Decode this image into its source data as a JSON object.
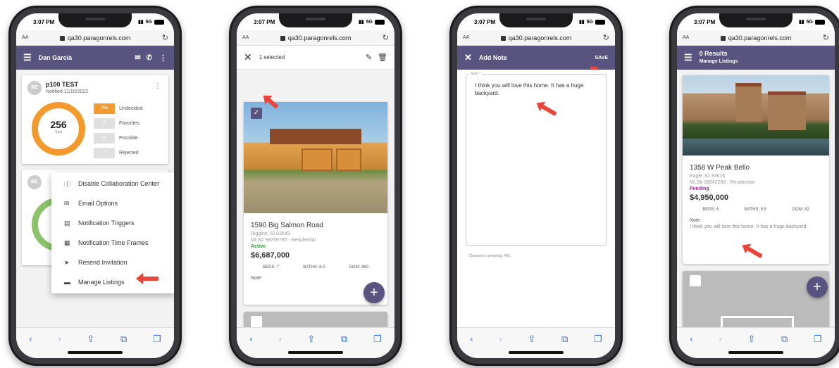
{
  "device": {
    "time": "3:07 PM",
    "network": "5G",
    "url_prefix": "AA",
    "url": "qa30.paragonrels.com",
    "reload_icon": "reload-icon"
  },
  "colors": {
    "appbar": "#58537f",
    "accent_orange": "#f29a2e",
    "active_green": "#2e9a3a",
    "pending_purple": "#9a2e9a",
    "annotation_red": "#e8453c"
  },
  "screen1": {
    "user_name": "Dan Garcia",
    "card": {
      "avatar": "BE",
      "title": "p100 TEST",
      "subtitle": "Notified 11/10/2022",
      "total_value": "256",
      "total_label": "Total",
      "breakdown": [
        {
          "count": "256",
          "label": "Undecided"
        },
        {
          "count": "0",
          "label": "Favorites"
        },
        {
          "count": "0",
          "label": "Possible"
        },
        {
          "count": "0",
          "label": "Rejected"
        }
      ]
    },
    "card2_avatar": "BE",
    "menu": [
      {
        "icon": "info-icon",
        "label": "Disable Collaboration Center"
      },
      {
        "icon": "email-icon",
        "label": "Email Options"
      },
      {
        "icon": "notification-trigger-icon",
        "label": "Notification Triggers"
      },
      {
        "icon": "calendar-icon",
        "label": "Notification Time Frames"
      },
      {
        "icon": "send-icon",
        "label": "Resend Invitation"
      },
      {
        "icon": "folder-icon",
        "label": "Manage Listings"
      }
    ]
  },
  "screen2": {
    "selected_text": "1 selected",
    "listing": {
      "address": "1590 Big Salmon Road",
      "city": "Riggins, ID 83549",
      "mls": "MLS# 98769785 - Residential",
      "status": "Active",
      "price": "$6,687,000",
      "beds": "BEDS: 7",
      "baths": "BATHS: 8.0",
      "dom": "DOM: 860",
      "note_label": "Note"
    }
  },
  "screen3": {
    "title": "Add Note",
    "save_label": "SAVE",
    "field_label": "Note *",
    "note_text": "I think you will love this home.  It has a huge backyard.",
    "chars_remaining": "Characters remaining: 455"
  },
  "screen4": {
    "results": "0 Results",
    "subtitle": "Manage Listings",
    "listing": {
      "address": "1358 W Peak Bello",
      "city": "Eagle, ID 83616",
      "mls": "MLS# 98842280 - Residential",
      "status": "Pending",
      "price": "$4,950,000",
      "beds": "BEDS: 6",
      "baths": "BATHS: 5.5",
      "dom": "DOM: 82",
      "note_label": "Note",
      "note_text": "I think you will love this home.  It has a huge backyard."
    }
  }
}
